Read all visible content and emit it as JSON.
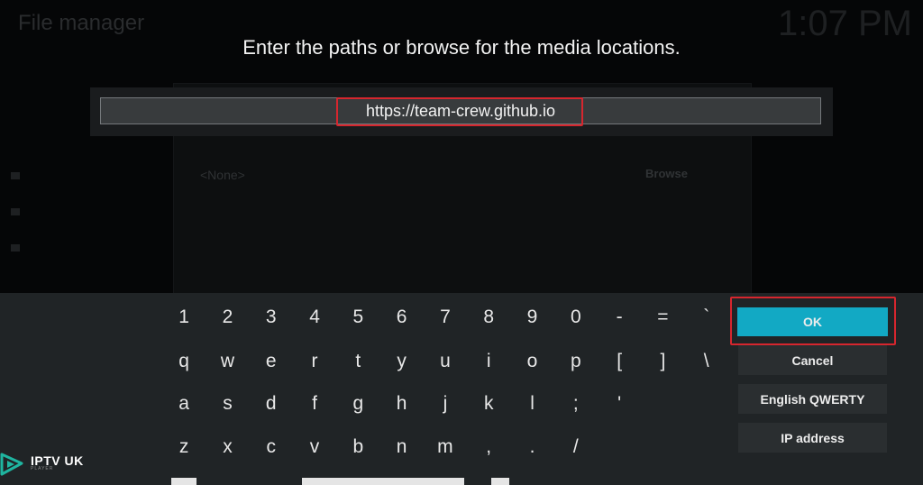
{
  "background": {
    "title": "File manager",
    "clock": "1:07 PM",
    "source_value": "<None>",
    "browse_label": "Browse",
    "sidebar_items": [
      "",
      "",
      ""
    ]
  },
  "dialog": {
    "heading": "Enter the paths or browse for the media locations.",
    "input_value": "https://team-crew.github.io"
  },
  "keyboard": {
    "rows": [
      [
        "1",
        "2",
        "3",
        "4",
        "5",
        "6",
        "7",
        "8",
        "9",
        "0",
        "-",
        "=",
        "`"
      ],
      [
        "q",
        "w",
        "e",
        "r",
        "t",
        "y",
        "u",
        "i",
        "o",
        "p",
        "[",
        "]",
        "\\"
      ],
      [
        "a",
        "s",
        "d",
        "f",
        "g",
        "h",
        "j",
        "k",
        "l",
        ";",
        "'"
      ],
      [
        "z",
        "x",
        "c",
        "v",
        "b",
        "n",
        "m",
        ",",
        ".",
        "/"
      ]
    ],
    "buttons": {
      "ok": "OK",
      "cancel": "Cancel",
      "layout": "English QWERTY",
      "ip": "IP address"
    }
  },
  "watermark": {
    "name": "IPTV UK",
    "tagline": "PLAYER"
  },
  "colors": {
    "highlight": "#d6262e",
    "ok_button": "#12a9c4"
  }
}
